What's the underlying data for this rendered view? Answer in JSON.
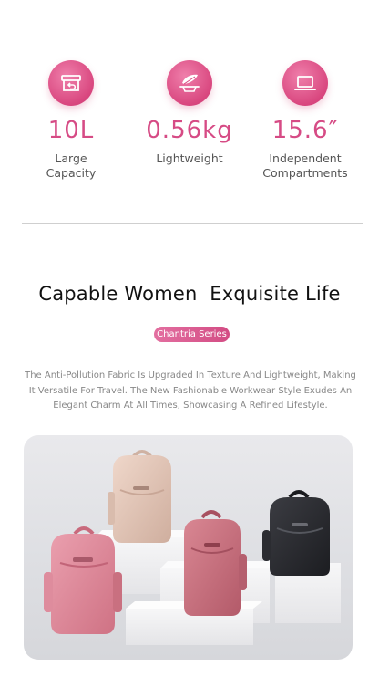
{
  "features": [
    {
      "icon": "box-return-icon",
      "value": "10L",
      "label_lines": [
        "Large",
        "Capacity"
      ]
    },
    {
      "icon": "feather-scale-icon",
      "value": "0.56kg",
      "label_lines": [
        "Lightweight"
      ]
    },
    {
      "icon": "laptop-icon",
      "value": "15.6″",
      "label_lines": [
        "Independent",
        "Compartments"
      ]
    }
  ],
  "headline": "Capable Women  Exquisite Life",
  "series_pill": "Chantria Series",
  "description_lines": [
    "The Anti-Pollution Fabric Is Upgraded In Texture And Lightweight, Making",
    "It Versatile For Travel. The New Fashionable Workwear Style Exudes An",
    "Elegant Charm At All Times, Showcasing A Refined Lifestyle."
  ],
  "colors": {
    "accent": "#d64b85",
    "badge": "#d9477f",
    "text_dark": "#111111",
    "text_muted": "#888888",
    "divider": "#cfcfcf",
    "bag_pink": "#de8a9c",
    "bag_beige": "#e2c3b3",
    "bag_rose": "#c9717f",
    "bag_black": "#2a2b30"
  },
  "photo": {
    "subject": "four-backpacks-on-white-pedestals",
    "bags": [
      "pink-backpack",
      "beige-backpack",
      "rose-backpack",
      "black-backpack"
    ]
  }
}
